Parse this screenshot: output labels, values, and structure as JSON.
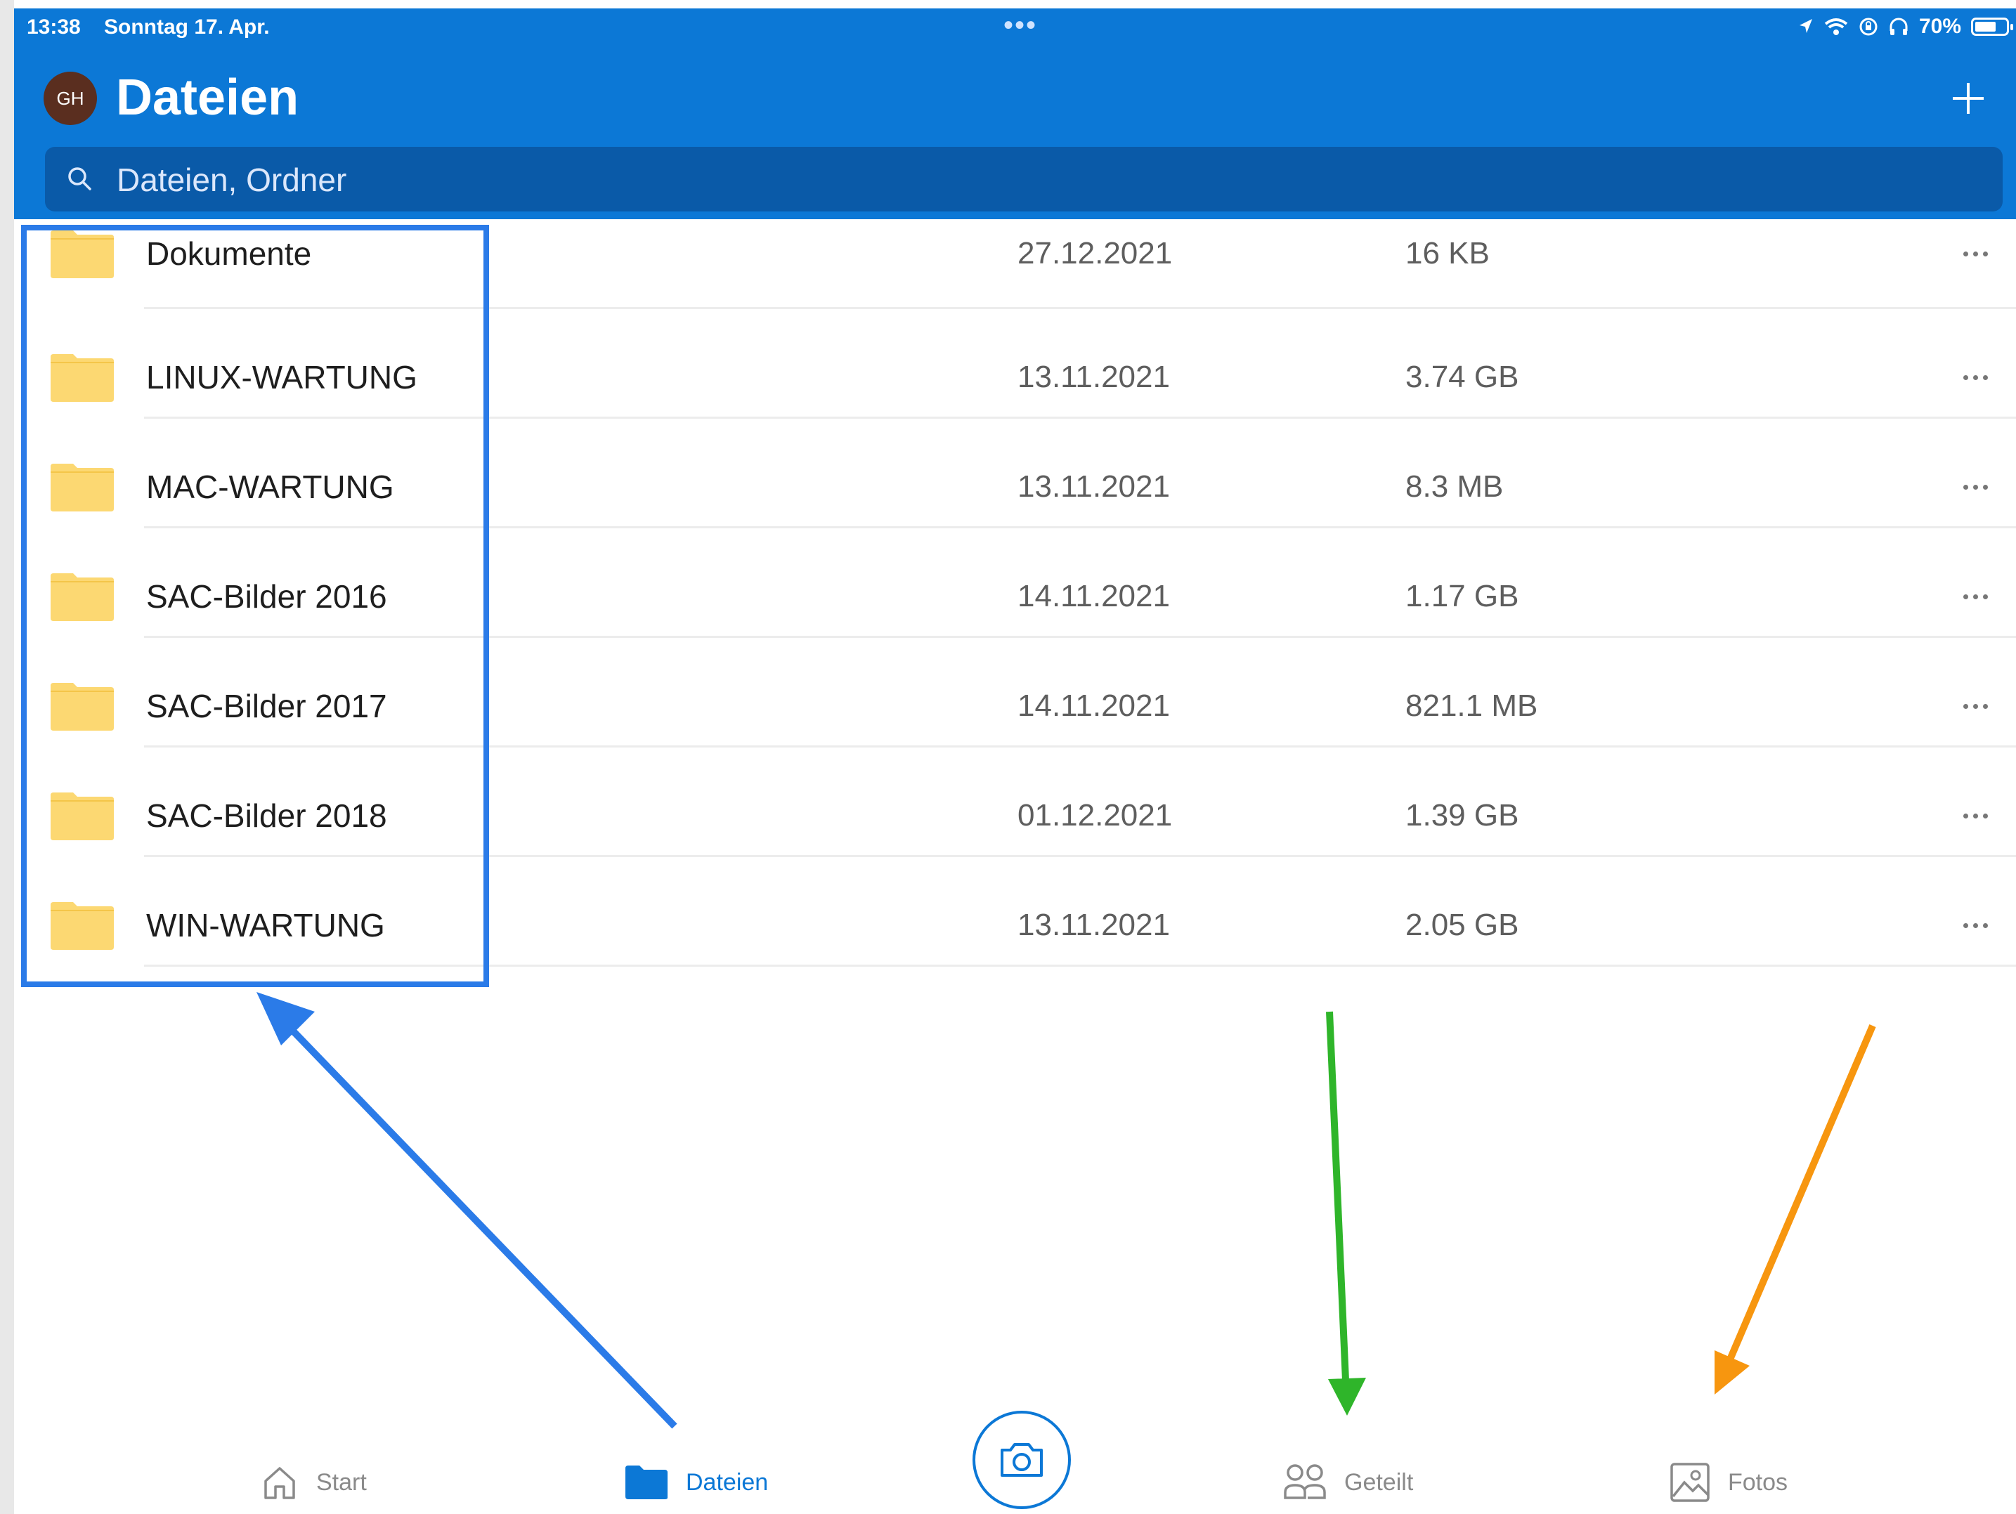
{
  "status_bar": {
    "time": "13:38",
    "date": "Sonntag 17. Apr.",
    "battery": "70%",
    "battery_level": 0.7
  },
  "header": {
    "avatar_initials": "GH",
    "title": "Dateien",
    "add_icon": "plus-icon"
  },
  "search": {
    "placeholder": "Dateien, Ordner"
  },
  "files": [
    {
      "name": "Dokumente",
      "date": "27.12.2021",
      "size": "16 KB"
    },
    {
      "name": "LINUX-WARTUNG",
      "date": "13.11.2021",
      "size": "3.74 GB"
    },
    {
      "name": "MAC-WARTUNG",
      "date": "13.11.2021",
      "size": "8.3 MB"
    },
    {
      "name": "SAC-Bilder 2016",
      "date": "14.11.2021",
      "size": "1.17 GB"
    },
    {
      "name": "SAC-Bilder 2017",
      "date": "14.11.2021",
      "size": "821.1 MB"
    },
    {
      "name": "SAC-Bilder 2018",
      "date": "01.12.2021",
      "size": "1.39 GB"
    },
    {
      "name": "WIN-WARTUNG",
      "date": "13.11.2021",
      "size": "2.05 GB"
    }
  ],
  "tabs": {
    "start": "Start",
    "dateien": "Dateien",
    "geteilt": "Geteilt",
    "fotos": "Fotos",
    "active": "dateien"
  },
  "colors": {
    "brand": "#0c78d6",
    "search_bg": "#0a5aa8",
    "folder": "#fcd872",
    "annotation_blue": "#2b7be8",
    "annotation_green": "#2fb52a",
    "annotation_orange": "#f7960f"
  }
}
